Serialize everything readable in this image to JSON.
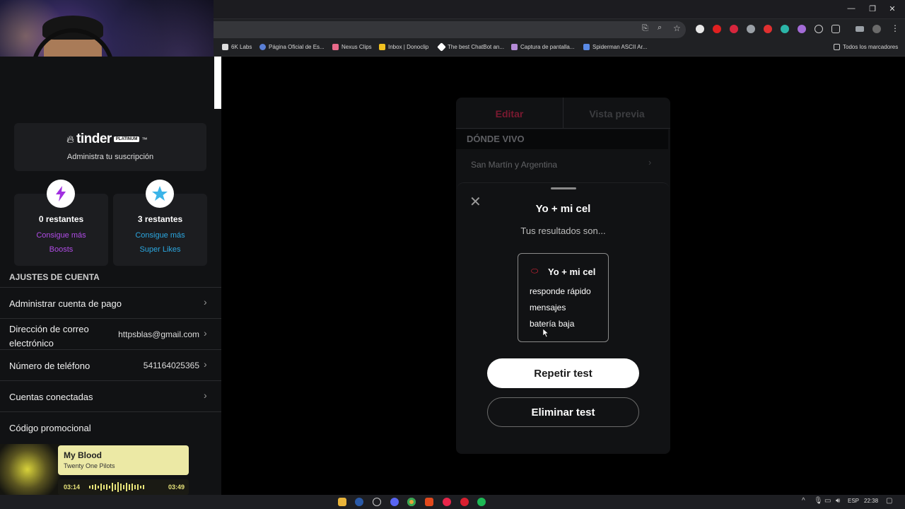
{
  "bookmarks": [
    {
      "label": "6K Labs"
    },
    {
      "label": "Página Oficial de Es..."
    },
    {
      "label": "Nexus Clips"
    },
    {
      "label": "Inbox | Donoclip"
    },
    {
      "label": "The best ChatBot an..."
    },
    {
      "label": "Captura de pantalla..."
    },
    {
      "label": "Spiderman ASCII Ar..."
    }
  ],
  "all_bookmarks": "Todos los marcadores",
  "tinder": {
    "brand": "tinder",
    "tier": "PLATINUM",
    "tm": "™",
    "manage": "Administra tu suscripción",
    "boosts": {
      "count": "0 restantes",
      "link1": "Consigue más",
      "link2": "Boosts"
    },
    "superlikes": {
      "count": "3 restantes",
      "link1": "Consigue más",
      "link2": "Super Likes"
    },
    "section_title": "AJUSTES DE CUENTA",
    "rows": [
      {
        "label": "Administrar cuenta de pago",
        "value": ""
      },
      {
        "label": "Dirección de correo electrónico",
        "value": "httpsblas@gmail.com"
      },
      {
        "label": "Número de teléfono",
        "value": "541164025365"
      },
      {
        "label": "Cuentas conectadas",
        "value": ""
      },
      {
        "label": "Código promocional",
        "value": ""
      }
    ]
  },
  "editor": {
    "tab_edit": "Editar",
    "tab_preview": "Vista previa",
    "section": "DÓNDE VIVO",
    "location": "San Martín y Argentina"
  },
  "modal": {
    "title": "Yo + mi cel",
    "subtitle": "Tus resultados son...",
    "result_title": "Yo + mi cel",
    "results": [
      "responde rápido",
      "mensajes",
      "batería baja"
    ],
    "repeat": "Repetir test",
    "delete": "Eliminar test"
  },
  "music": {
    "title": "My Blood",
    "artist": "Twenty One Pilots",
    "elapsed": "03:14",
    "total": "03:49"
  },
  "taskbar": {
    "lang": "ESP",
    "time": "22:38"
  }
}
